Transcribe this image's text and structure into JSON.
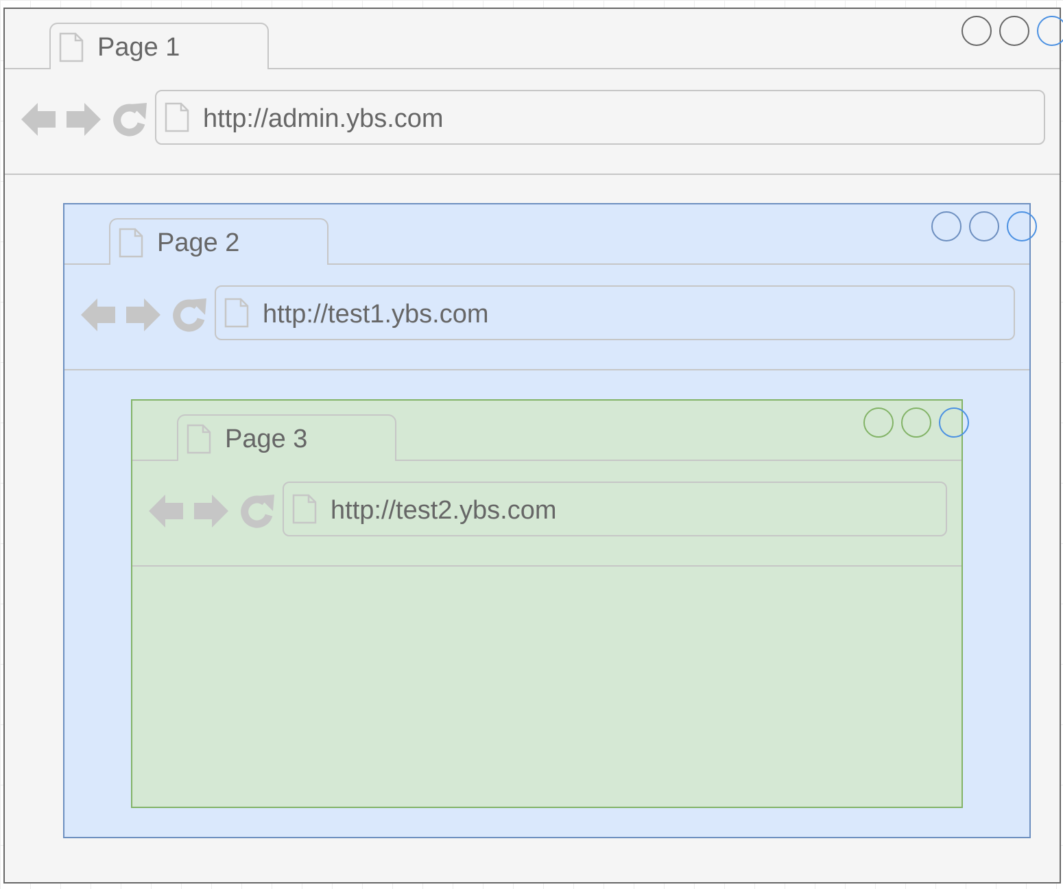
{
  "colors": {
    "outer_fill": "#f5f5f5",
    "outer_stroke": "#666666",
    "middle_fill": "#dae8fc",
    "middle_stroke": "#6c8ebf",
    "inner_fill": "#d5e8d4",
    "inner_stroke": "#82b366",
    "chrome_gray": "#c6c6c6",
    "text": "#666666",
    "accent_blue": "#4a90e2"
  },
  "windows": [
    {
      "tab_label": "Page 1",
      "url": "http://admin.ybs.com"
    },
    {
      "tab_label": "Page 2",
      "url": "http://test1.ybs.com"
    },
    {
      "tab_label": "Page 3",
      "url": "http://test2.ybs.com"
    }
  ],
  "icons": {
    "tab": "page-icon",
    "back": "back-arrow-icon",
    "forward": "forward-arrow-icon",
    "reload": "reload-icon",
    "address": "page-icon",
    "window_controls": "circle-icon"
  }
}
